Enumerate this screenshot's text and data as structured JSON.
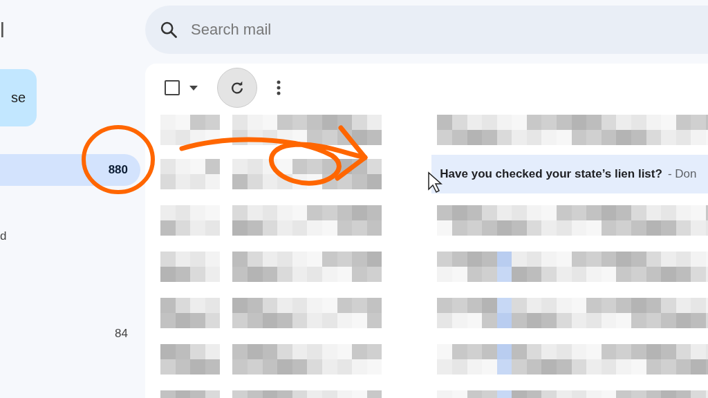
{
  "sidebar": {
    "logo_fragment": "l",
    "compose_button": "se",
    "items": [
      {
        "count": "880",
        "selected": true
      },
      {
        "label": "d",
        "selected": false
      },
      {
        "count": "84",
        "selected": false
      }
    ]
  },
  "search": {
    "placeholder": "Search mail"
  },
  "toolbar": {
    "select_all_checked": false
  },
  "highlighted_email": {
    "subject": "Have you checked your state’s lien list?",
    "snippet": "- Don"
  }
}
